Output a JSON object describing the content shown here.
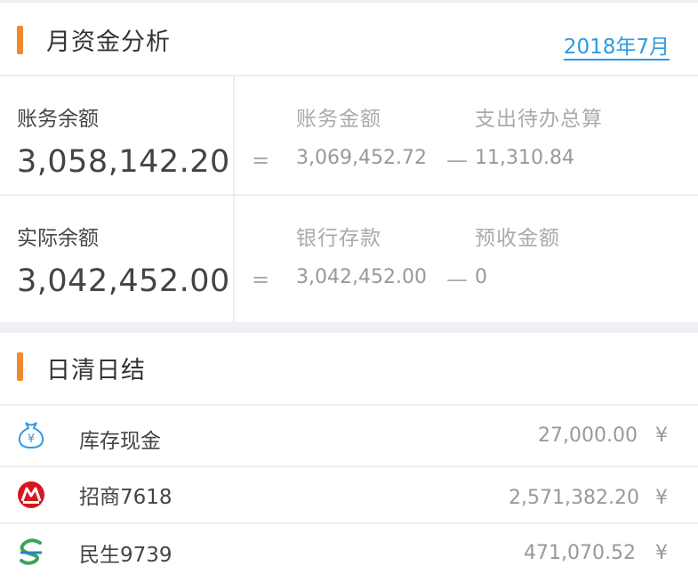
{
  "monthly": {
    "title": "月资金分析",
    "month": "2018年7月"
  },
  "book_balance": {
    "label": "账务余额",
    "value": "3,058,142.20",
    "eq": "=",
    "minus": "—",
    "term1_label": "账务金额",
    "term1_value": "3,069,452.72",
    "term2_label": "支出待办总算",
    "term2_value": "11,310.84"
  },
  "actual_balance": {
    "label": "实际余额",
    "value": "3,042,452.00",
    "eq": "=",
    "minus": "—",
    "term1_label": "银行存款",
    "term1_value": "3,042,452.00",
    "term2_label": "预收金额",
    "term2_value": "0"
  },
  "daily": {
    "title": "日清日结",
    "currency": "¥",
    "items": [
      {
        "label": "库存现金",
        "value": "27,000.00",
        "icon": "money-bag-icon"
      },
      {
        "label": "招商7618",
        "value": "2,571,382.20",
        "icon": "cmb-logo-icon"
      },
      {
        "label": "民生9739",
        "value": "471,070.52",
        "icon": "cmbc-logo-icon"
      }
    ]
  },
  "colors": {
    "accent": "#f08a2c",
    "link": "#2e9be0",
    "cmb_red": "#d7161e",
    "cmbc_green": "#3aa35a",
    "cmbc_blue": "#2f7fd1"
  }
}
